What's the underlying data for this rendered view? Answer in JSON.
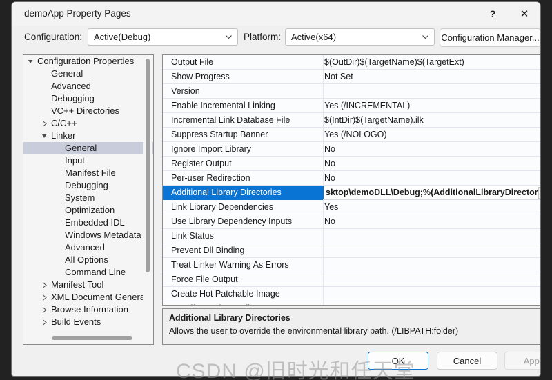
{
  "window": {
    "title": "demoApp Property Pages",
    "help_icon": "?",
    "close_icon": "✕"
  },
  "config_bar": {
    "configuration_label": "Configuration:",
    "configuration_value": "Active(Debug)",
    "platform_label": "Platform:",
    "platform_value": "Active(x64)",
    "configuration_manager_label": "Configuration Manager..."
  },
  "tree": {
    "items": [
      {
        "label": "Configuration Properties",
        "indent": 0,
        "arrow": "expanded",
        "selected": false
      },
      {
        "label": "General",
        "indent": 1,
        "arrow": "none",
        "selected": false
      },
      {
        "label": "Advanced",
        "indent": 1,
        "arrow": "none",
        "selected": false
      },
      {
        "label": "Debugging",
        "indent": 1,
        "arrow": "none",
        "selected": false
      },
      {
        "label": "VC++ Directories",
        "indent": 1,
        "arrow": "none",
        "selected": false
      },
      {
        "label": "C/C++",
        "indent": 1,
        "arrow": "collapsed",
        "selected": false
      },
      {
        "label": "Linker",
        "indent": 1,
        "arrow": "expanded",
        "selected": false
      },
      {
        "label": "General",
        "indent": 2,
        "arrow": "none",
        "selected": true
      },
      {
        "label": "Input",
        "indent": 2,
        "arrow": "none",
        "selected": false
      },
      {
        "label": "Manifest File",
        "indent": 2,
        "arrow": "none",
        "selected": false
      },
      {
        "label": "Debugging",
        "indent": 2,
        "arrow": "none",
        "selected": false
      },
      {
        "label": "System",
        "indent": 2,
        "arrow": "none",
        "selected": false
      },
      {
        "label": "Optimization",
        "indent": 2,
        "arrow": "none",
        "selected": false
      },
      {
        "label": "Embedded IDL",
        "indent": 2,
        "arrow": "none",
        "selected": false
      },
      {
        "label": "Windows Metadata",
        "indent": 2,
        "arrow": "none",
        "selected": false
      },
      {
        "label": "Advanced",
        "indent": 2,
        "arrow": "none",
        "selected": false
      },
      {
        "label": "All Options",
        "indent": 2,
        "arrow": "none",
        "selected": false
      },
      {
        "label": "Command Line",
        "indent": 2,
        "arrow": "none",
        "selected": false
      },
      {
        "label": "Manifest Tool",
        "indent": 1,
        "arrow": "collapsed",
        "selected": false
      },
      {
        "label": "XML Document Genera",
        "indent": 1,
        "arrow": "collapsed",
        "selected": false
      },
      {
        "label": "Browse Information",
        "indent": 1,
        "arrow": "collapsed",
        "selected": false
      },
      {
        "label": "Build Events",
        "indent": 1,
        "arrow": "collapsed",
        "selected": false
      }
    ]
  },
  "grid": {
    "rows": [
      {
        "name": "Output File",
        "value": "$(OutDir)$(TargetName)$(TargetExt)",
        "selected": false,
        "dropdown": false
      },
      {
        "name": "Show Progress",
        "value": "Not Set",
        "selected": false,
        "dropdown": false
      },
      {
        "name": "Version",
        "value": "",
        "selected": false,
        "dropdown": false
      },
      {
        "name": "Enable Incremental Linking",
        "value": "Yes (/INCREMENTAL)",
        "selected": false,
        "dropdown": false
      },
      {
        "name": "Incremental Link Database File",
        "value": "$(IntDir)$(TargetName).ilk",
        "selected": false,
        "dropdown": false
      },
      {
        "name": "Suppress Startup Banner",
        "value": "Yes (/NOLOGO)",
        "selected": false,
        "dropdown": false
      },
      {
        "name": "Ignore Import Library",
        "value": "No",
        "selected": false,
        "dropdown": false
      },
      {
        "name": "Register Output",
        "value": "No",
        "selected": false,
        "dropdown": false
      },
      {
        "name": "Per-user Redirection",
        "value": "No",
        "selected": false,
        "dropdown": false
      },
      {
        "name": "Additional Library Directories",
        "value": "sktop\\demoDLL\\Debug;%(AdditionalLibraryDirectories)",
        "selected": true,
        "dropdown": true
      },
      {
        "name": "Link Library Dependencies",
        "value": "Yes",
        "selected": false,
        "dropdown": false
      },
      {
        "name": "Use Library Dependency Inputs",
        "value": "No",
        "selected": false,
        "dropdown": false
      },
      {
        "name": "Link Status",
        "value": "",
        "selected": false,
        "dropdown": false
      },
      {
        "name": "Prevent Dll Binding",
        "value": "",
        "selected": false,
        "dropdown": false
      },
      {
        "name": "Treat Linker Warning As Errors",
        "value": "",
        "selected": false,
        "dropdown": false
      },
      {
        "name": "Force File Output",
        "value": "",
        "selected": false,
        "dropdown": false
      },
      {
        "name": "Create Hot Patchable Image",
        "value": "",
        "selected": false,
        "dropdown": false
      },
      {
        "name": "Specify Section Attributes",
        "value": "",
        "selected": false,
        "dropdown": false
      }
    ]
  },
  "description": {
    "title": "Additional Library Directories",
    "body": "Allows the user to override the environmental library path. (/LIBPATH:folder)"
  },
  "footer": {
    "ok_label": "OK",
    "cancel_label": "Cancel",
    "apply_label": "Apply"
  },
  "watermark": {
    "text": "CSDN @旧时光和任天堂"
  },
  "colors": {
    "accent": "#0a74d4",
    "tree_selection": "#c9cddb",
    "dialog_bg": "#f0f0f0",
    "grid_bg": "#fbfcfe"
  }
}
